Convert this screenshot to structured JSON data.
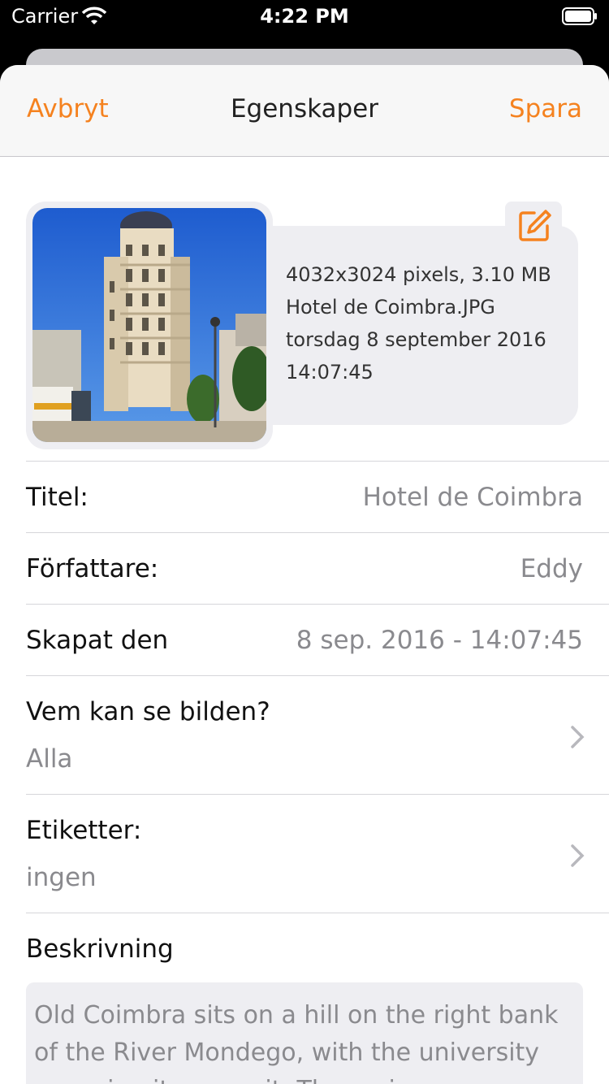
{
  "status_bar": {
    "carrier": "Carrier",
    "time": "4:22 PM"
  },
  "nav": {
    "cancel": "Avbryt",
    "title": "Egenskaper",
    "save": "Spara"
  },
  "image_info": {
    "dimensions_size": "4032x3024 pixels, 3.10 MB",
    "filename": "Hotel de Coimbra.JPG",
    "date": "torsdag 8 september 2016",
    "time": "14:07:45"
  },
  "fields": {
    "title": {
      "label": "Titel:",
      "value": "Hotel de Coimbra"
    },
    "author": {
      "label": "Författare:",
      "value": "Eddy"
    },
    "created": {
      "label": "Skapat den",
      "value": "8 sep. 2016 - 14:07:45"
    },
    "visibility": {
      "label": "Vem kan se bilden?",
      "value": "Alla"
    },
    "tags": {
      "label": "Etiketter:",
      "value": "ingen"
    },
    "description": {
      "label": "Beskrivning",
      "value": "Old Coimbra sits on a hill on the right bank of the River Mondego, with the university crowning its summit. The main"
    }
  },
  "icons": {
    "edit": "edit-icon",
    "chevron": "chevron-right-icon",
    "wifi": "wifi-icon",
    "battery": "battery-icon"
  },
  "colors": {
    "accent": "#f5821f",
    "secondary_text": "#8a8a8e",
    "card": "#eeeef2"
  }
}
